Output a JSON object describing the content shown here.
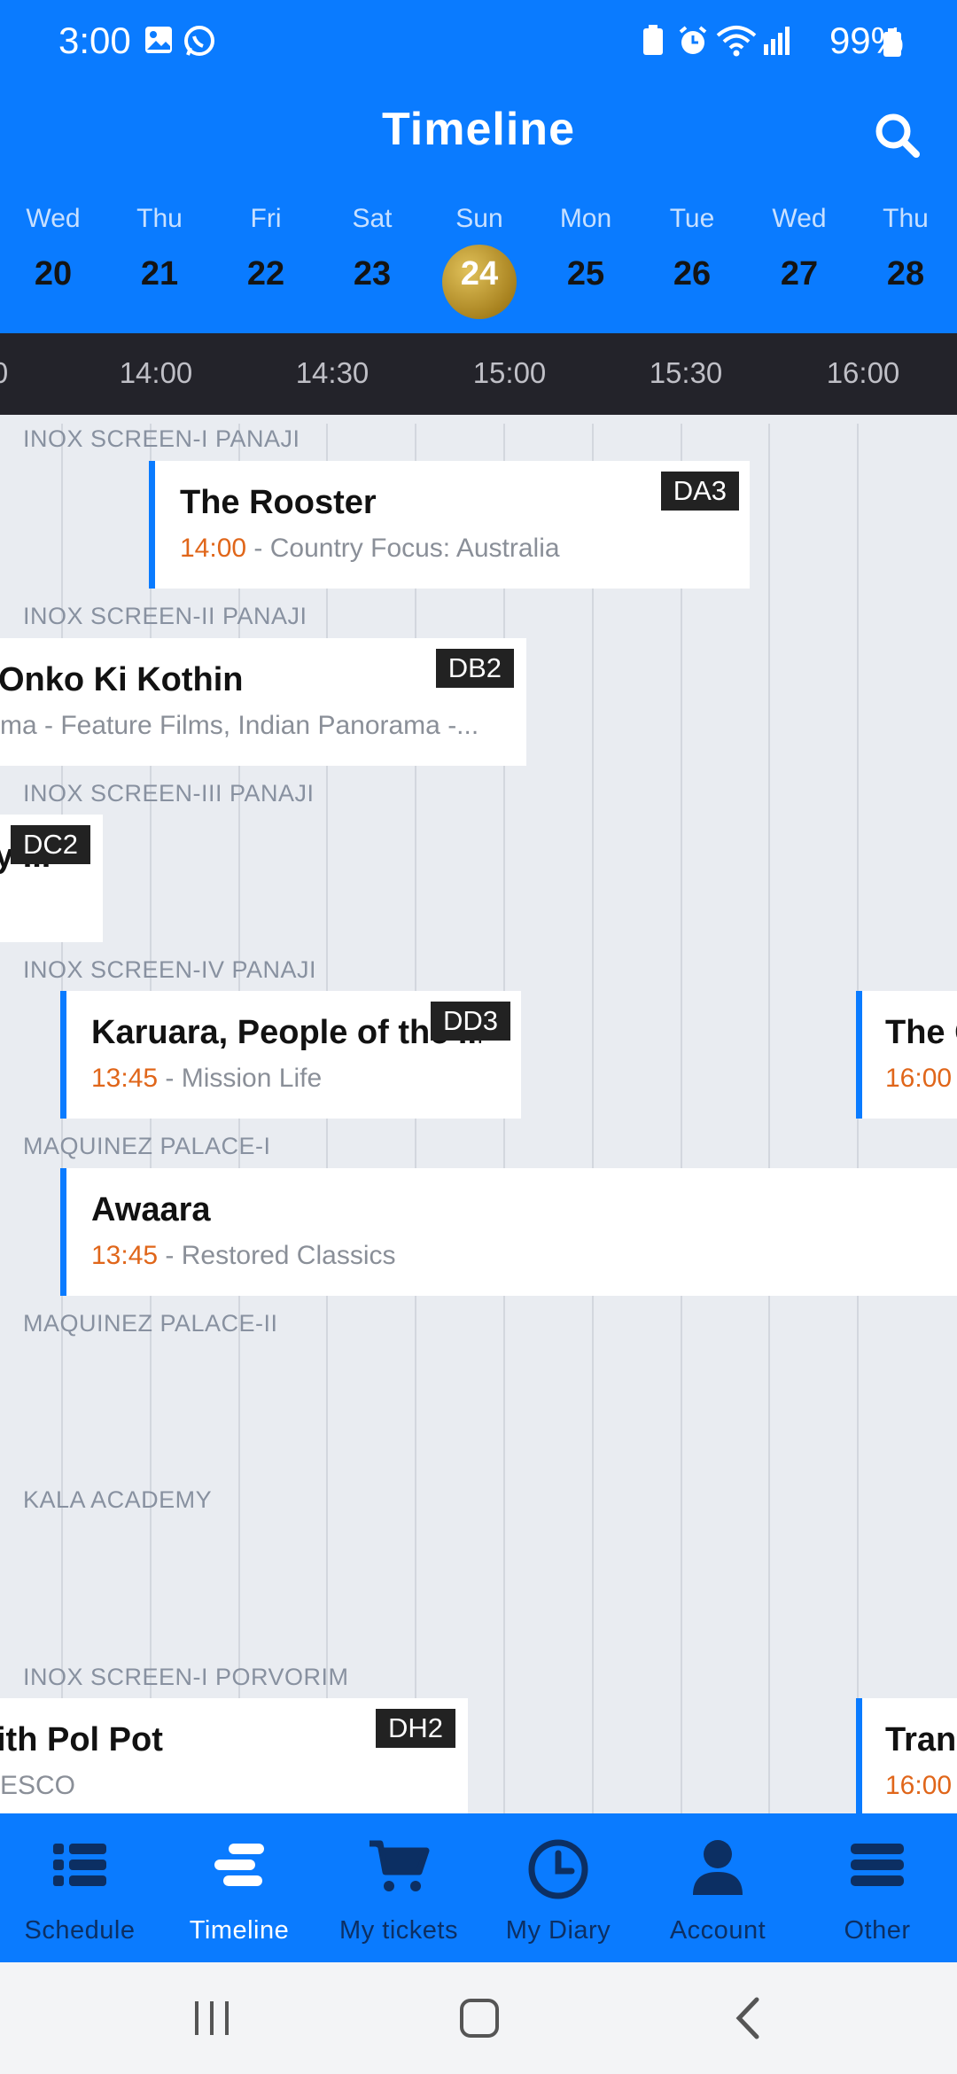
{
  "status_bar": {
    "time": "3:00",
    "battery": "99%"
  },
  "header": {
    "title": "Timeline"
  },
  "dates": [
    {
      "day": "Wed",
      "num": "20"
    },
    {
      "day": "Thu",
      "num": "21"
    },
    {
      "day": "Fri",
      "num": "22"
    },
    {
      "day": "Sat",
      "num": "23"
    },
    {
      "day": "Sun",
      "num": "24",
      "selected": true
    },
    {
      "day": "Mon",
      "num": "25"
    },
    {
      "day": "Tue",
      "num": "26"
    },
    {
      "day": "Wed",
      "num": "27"
    },
    {
      "day": "Thu",
      "num": "28"
    }
  ],
  "time_ticks": [
    "14:00",
    "14:30",
    "15:00",
    "15:30",
    "16:00"
  ],
  "venues": [
    "INOX SCREEN-I PANAJI",
    "INOX SCREEN-II PANAJI",
    "INOX SCREEN-III PANAJI",
    "INOX SCREEN-IV PANAJI",
    "MAQUINEZ PALACE-I",
    "MAQUINEZ PALACE-II",
    "KALA ACADEMY",
    "INOX SCREEN-I PORVORIM"
  ],
  "events": {
    "rooster": {
      "title": "The Rooster",
      "time": "14:00",
      "meta": " - Country Focus: Australia",
      "badge": "DA3"
    },
    "onko": {
      "title": "Onko Ki Kothin",
      "meta": "ma - Feature Films, Indian Panorama -...",
      "badge": "DB2"
    },
    "dc2": {
      "title": "y ...",
      "badge": "DC2"
    },
    "karuara": {
      "title": "Karuara, People of the ...",
      "time": "13:45",
      "meta": " - Mission Life",
      "badge": "DD3"
    },
    "the_c": {
      "title": "The C",
      "time": "16:00",
      "meta": " -"
    },
    "awaara": {
      "title": "Awaara",
      "time": "13:45",
      "meta": " - Restored Classics"
    },
    "polpot": {
      "title": "ith Pol Pot",
      "meta": "ESCO",
      "badge": "DH2"
    },
    "tran": {
      "title": "Tran",
      "time": "16:00",
      "meta": " -"
    }
  },
  "bottom_nav": [
    "Schedule",
    "Timeline",
    "My tickets",
    "My Diary",
    "Account",
    "Other"
  ],
  "colors": {
    "primary": "#0a7bff",
    "accent_time": "#e0661a",
    "selected_date": "#c29a2e"
  }
}
